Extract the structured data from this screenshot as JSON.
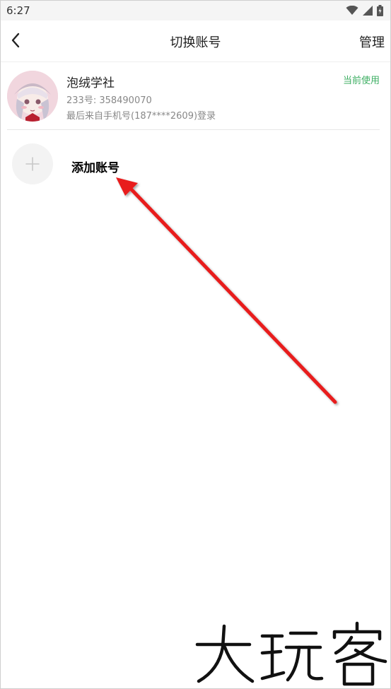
{
  "status_bar": {
    "time": "6:27",
    "icons": [
      "wifi-icon",
      "signal-icon",
      "battery-icon"
    ]
  },
  "header": {
    "back_icon": "back-arrow-icon",
    "title": "切换账号",
    "manage_label": "管理"
  },
  "accounts": [
    {
      "name": "泡绒学社",
      "uid": "233号: 358490070",
      "last_login": "最后来自手机号(187****2609)登录",
      "status": "当前使用",
      "status_color": "#3cae62"
    }
  ],
  "add_account": {
    "icon": "plus-icon",
    "label": "添加账号"
  },
  "annotation": {
    "arrow_color": "#e81c1c"
  },
  "watermark": {
    "text": "大玩客"
  }
}
